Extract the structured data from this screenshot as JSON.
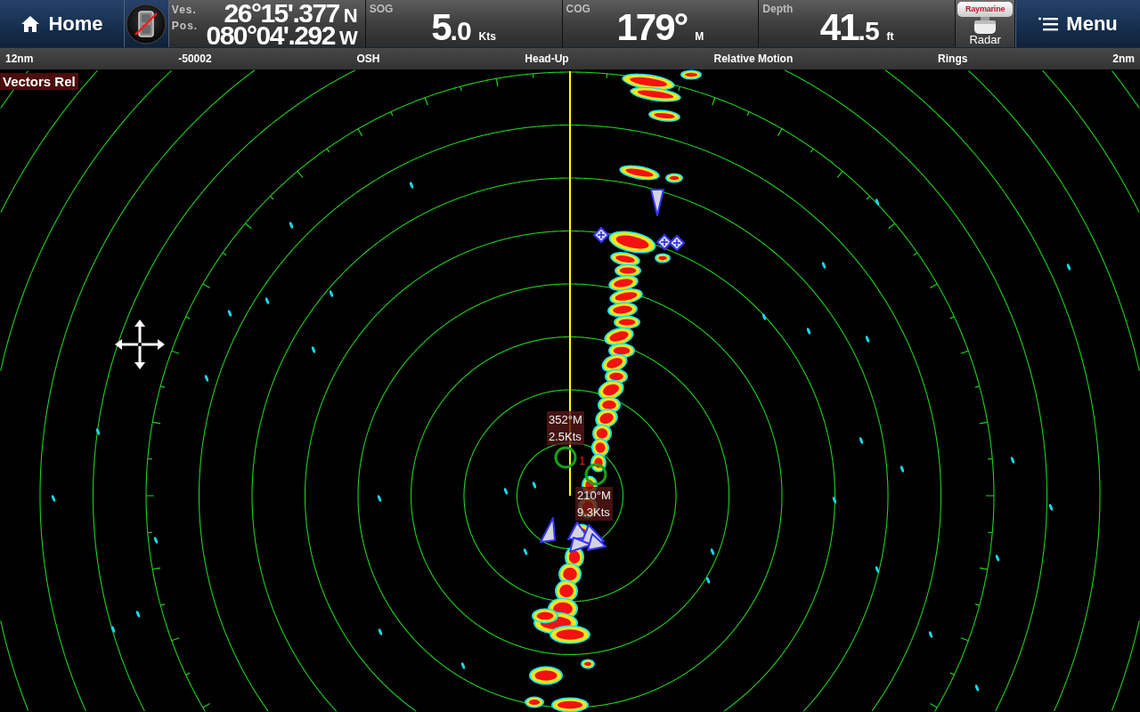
{
  "top_bar": {
    "home_button": {
      "label": "Home"
    },
    "connection_button": {
      "connected": false
    },
    "vessel_position": {
      "label_lines": [
        "Ves.",
        "Pos."
      ],
      "latitude": {
        "value": "26°15'.377",
        "hemisphere": "N"
      },
      "longitude": {
        "value": "080°04'.292",
        "hemisphere": "W"
      }
    },
    "readouts": [
      {
        "label": "SOG",
        "value": "5",
        "decimal": ".0",
        "unit": "Kts"
      },
      {
        "label": "COG",
        "value": "179°",
        "unit": "M"
      },
      {
        "label": "Depth",
        "value": "41",
        "decimal": ".5",
        "unit": "ft"
      }
    ],
    "radar_button": {
      "brand": "Raymarine",
      "label": "Radar"
    },
    "menu_button": {
      "label": "Menu"
    }
  },
  "status_strip": [
    "12nm",
    "-50002",
    "OSH",
    "Head-Up",
    "Relative Motion",
    "Rings",
    "2nm"
  ],
  "radar_view": {
    "vectors_label": "Vectors Rel",
    "tracked_targets": [
      {
        "id": "1",
        "bearing": "352°M",
        "speed": "2.5Kts"
      },
      {
        "bearing": "210°M",
        "speed": "9.3Kts"
      }
    ]
  }
}
